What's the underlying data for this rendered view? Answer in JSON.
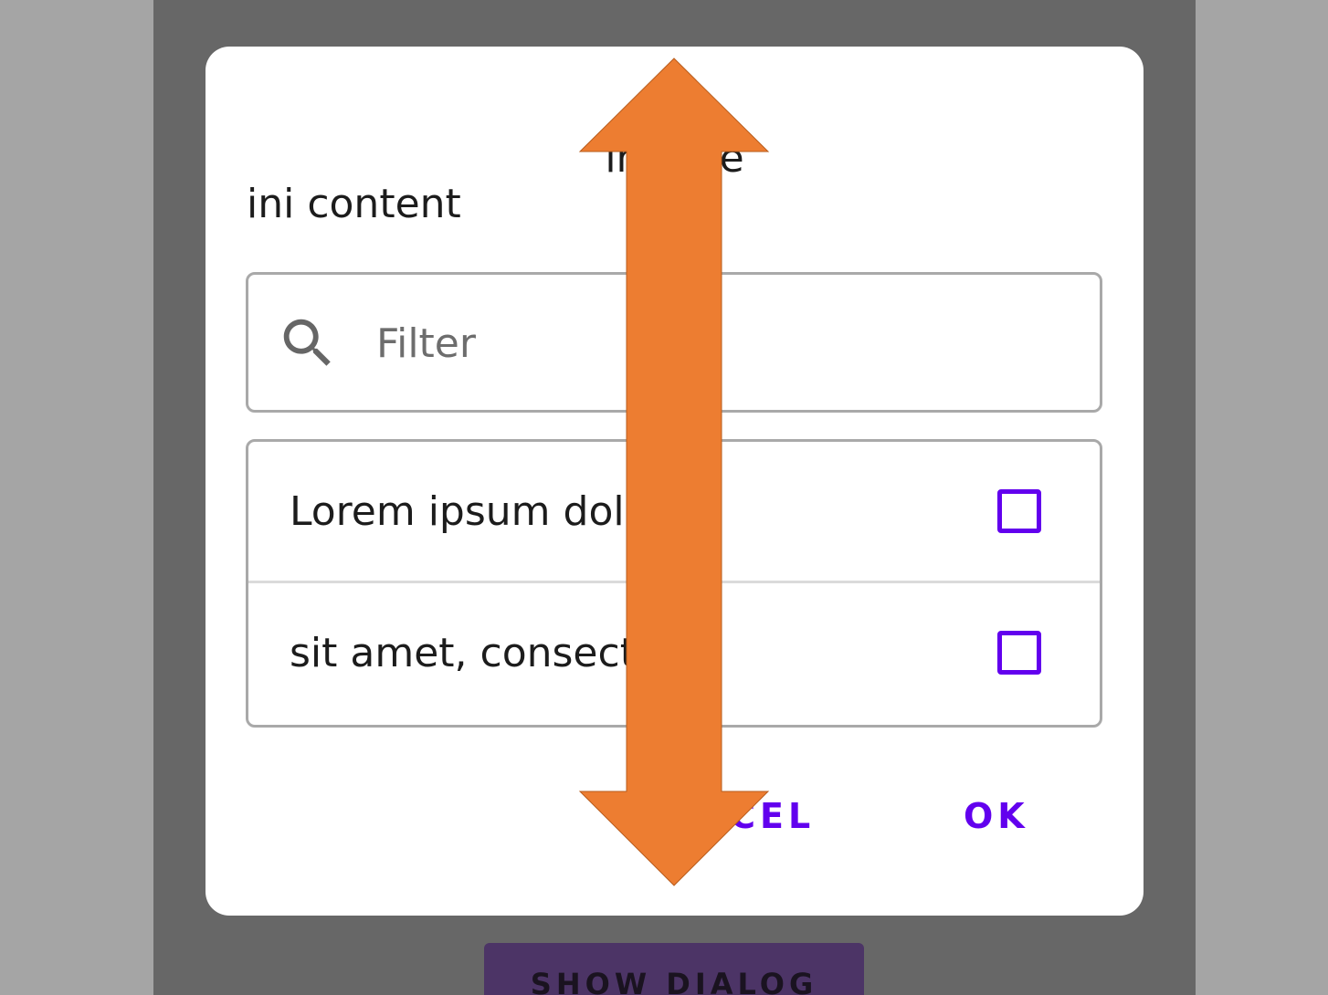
{
  "background_button": {
    "label": "SHOW DIALOG"
  },
  "dialog": {
    "title": "ini title",
    "content": "ini content",
    "filter": {
      "placeholder": "Filter",
      "value": ""
    },
    "items": [
      {
        "label": "Lorem ipsum dolor",
        "checked": false
      },
      {
        "label": "sit amet, consectetur",
        "checked": false
      }
    ],
    "buttons": {
      "cancel": "CANCEL",
      "ok": "OK"
    }
  },
  "icons": {
    "search": "search-icon",
    "overlay": "double-headed-arrow-icon"
  },
  "colors": {
    "accent": "#6200ee",
    "scrim": "#676767",
    "outer_background": "#a5a5a5",
    "arrow_fill": "#ed7d31",
    "button_background": "#4c3466"
  }
}
